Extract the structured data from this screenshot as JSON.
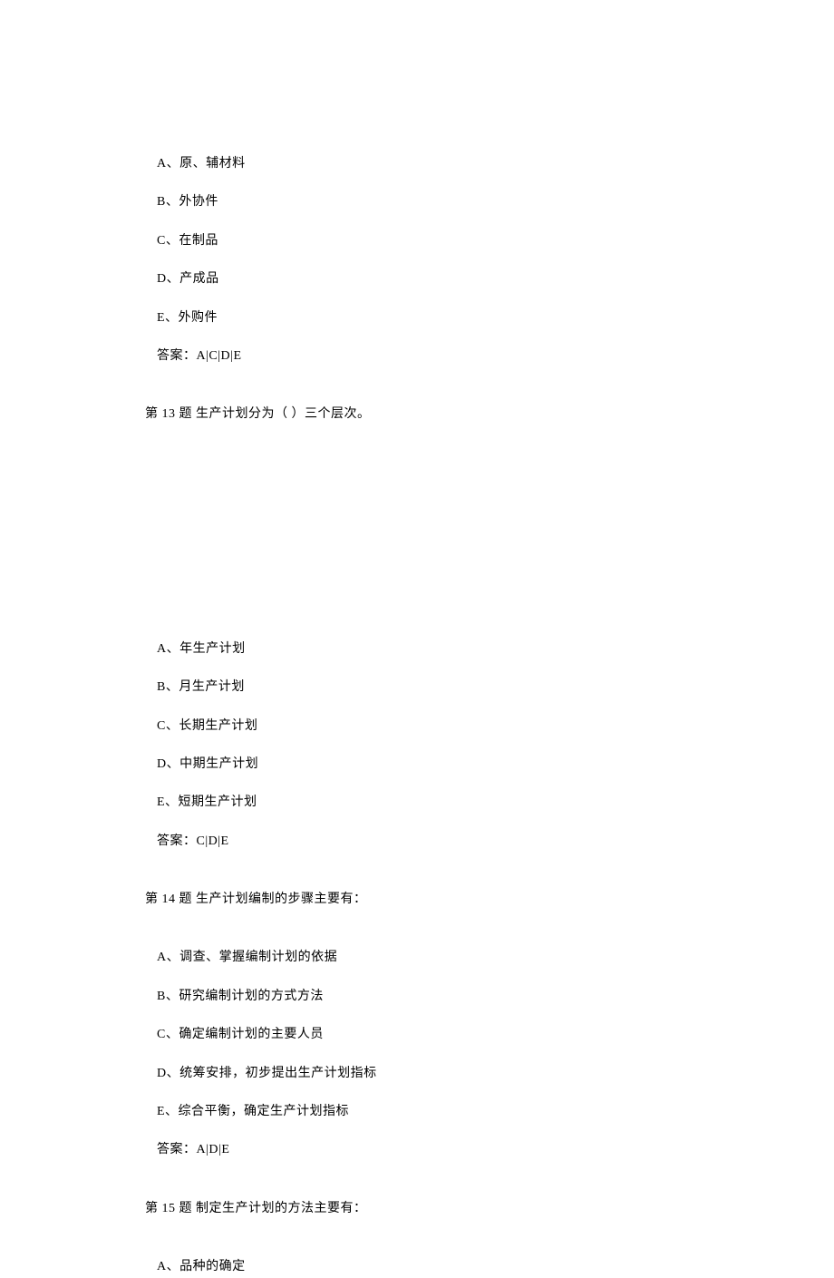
{
  "block1": {
    "options": {
      "A": "A、原、辅材料",
      "B": "B、外协件",
      "C": "C、在制品",
      "D": "D、产成品",
      "E": "E、外购件"
    },
    "answer": "答案：A|C|D|E"
  },
  "q13": {
    "question": "第 13 题  生产计划分为（ ）三个层次。",
    "options": {
      "A": "A、年生产计划",
      "B": "B、月生产计划",
      "C": "C、长期生产计划",
      "D": "D、中期生产计划",
      "E": "E、短期生产计划"
    },
    "answer": "答案：C|D|E"
  },
  "q14": {
    "question": "第 14 题  生产计划编制的步骤主要有：",
    "options": {
      "A": "A、调查、掌握编制计划的依据",
      "B": "B、研究编制计划的方式方法",
      "C": "C、确定编制计划的主要人员",
      "D": "D、统筹安排，初步提出生产计划指标",
      "E": "E、综合平衡，确定生产计划指标"
    },
    "answer": "答案：A|D|E"
  },
  "q15": {
    "question": "第 15 题  制定生产计划的方法主要有：",
    "options": {
      "A": "A、品种的确定"
    }
  }
}
